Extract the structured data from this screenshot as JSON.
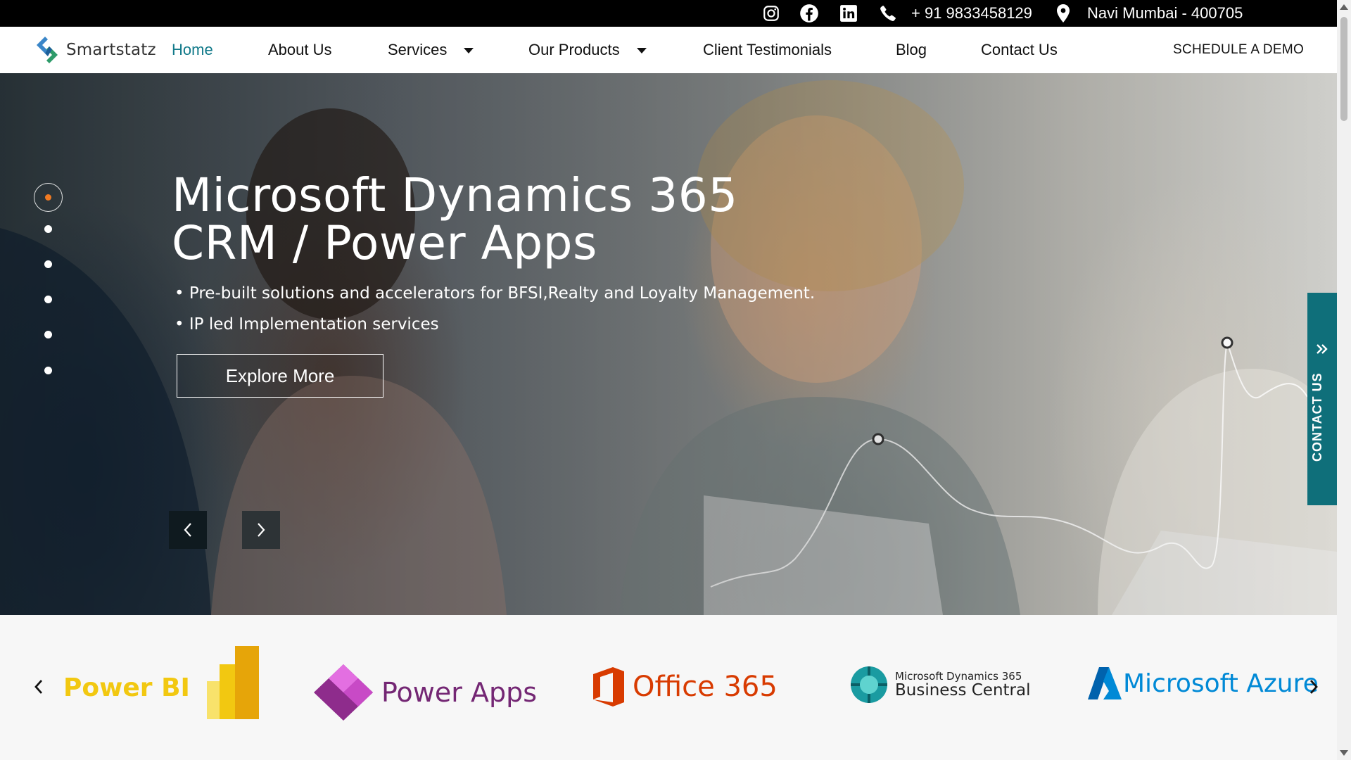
{
  "topbar": {
    "phone": "+ 91 9833458129",
    "location": "Navi Mumbai - 400705",
    "icons": [
      "instagram-icon",
      "facebook-icon",
      "linkedin-icon",
      "phone-icon",
      "location-pin-icon"
    ]
  },
  "brand": {
    "name": "Smartstatz"
  },
  "nav": {
    "items": [
      {
        "label": "Home",
        "active": true
      },
      {
        "label": "About Us"
      },
      {
        "label": "Services",
        "dropdown": true
      },
      {
        "label": "Our Products",
        "dropdown": true
      },
      {
        "label": "Client Testimonials"
      },
      {
        "label": "Blog"
      },
      {
        "label": "Contact Us"
      }
    ],
    "cta": "SCHEDULE A DEMO"
  },
  "hero": {
    "title_line1": "Microsoft Dynamics 365",
    "title_line2": "CRM / Power Apps",
    "bullets": [
      "• Pre-built solutions and accelerators for BFSI,Realty and Loyalty Management.",
      "• IP led Implementation services"
    ],
    "button": "Explore More",
    "slide_count": 6,
    "active_slide": 1
  },
  "contact_tab": {
    "label": "CONTACT US"
  },
  "partners": {
    "items": [
      {
        "name": "Power BI"
      },
      {
        "name": "Power Apps"
      },
      {
        "name": "Office 365"
      },
      {
        "name_top": "Microsoft Dynamics 365",
        "name_bottom": "Business Central"
      },
      {
        "name": "Microsoft Azure"
      }
    ]
  },
  "colors": {
    "accent_teal": "#127a8a",
    "contact_tab": "#0f6f7a",
    "active_dot": "#f07a22",
    "power_bi": "#f2c811",
    "power_apps": "#742774",
    "office": "#d83b01",
    "azure": "#0089d6"
  }
}
